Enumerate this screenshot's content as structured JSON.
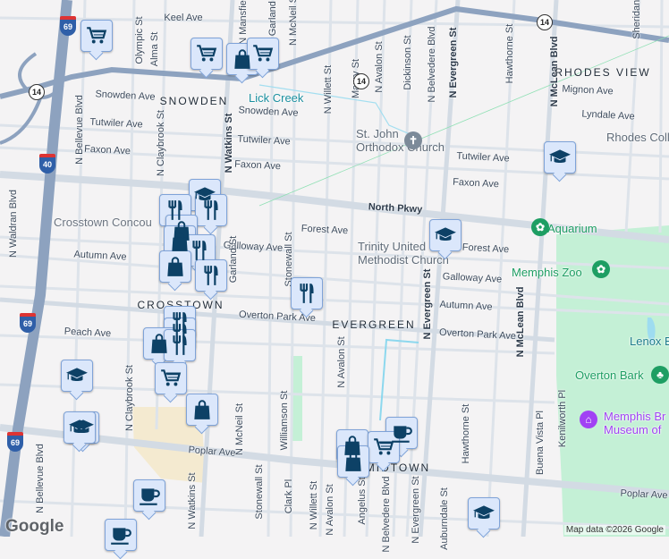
{
  "colors": {
    "road": "#d3dbe4",
    "highway": "#8da2bf",
    "park": "#bfeed3",
    "pin_icon": "#0d4166",
    "water": "#9edcf0",
    "zoo": "#1e9e63",
    "museum": "#a142f4"
  },
  "streets": [
    "Keel Ave",
    "Snowden Ave",
    "Snowden Ave",
    "Tutwiler Ave",
    "Tutwiler Ave",
    "Tutwiler Ave",
    "Faxon Ave",
    "Faxon Ave",
    "Faxon Ave",
    "North Pkwy",
    "Forest Ave",
    "Forest Ave",
    "Galloway Ave",
    "Galloway Ave",
    "Autumn Ave",
    "Autumn Ave",
    "Overton Park Ave",
    "Overton Park Ave",
    "Mignon Ave",
    "Lyndale Ave",
    "Peach Ave",
    "Poplar Ave",
    "Poplar Ave",
    "Olympic St",
    "Alma St",
    "N Mansfield St",
    "Garland St",
    "N McNeil St",
    "N Willett St",
    "Maury St",
    "N Avalon St",
    "Dickinson St",
    "N Belvedere Blvd",
    "N Evergreen St",
    "Hawthorne St",
    "N McLean Blvd",
    "Sheridan St",
    "N Bellevue Blvd",
    "N Claybrook St",
    "N Watkins St",
    "N Waldran Blvd",
    "Stonewall St",
    "Garland St",
    "N Evergreen St",
    "N Avalon St",
    "Williamson St",
    "N Claybrook St",
    "N Watkins St",
    "N McNeil St",
    "Stonewall St",
    "Clark Pl",
    "N Willett St",
    "N Avalon St",
    "Angelus St",
    "N Belvedere Blvd",
    "N Evergreen St",
    "Auburndale St",
    "Hawthorne St",
    "N McLean Blvd",
    "Buena Vista Pl",
    "Kenilworth Pl",
    "N Bellevue Blvd"
  ],
  "neighborhoods": [
    "SNOWDEN",
    "RHODES VIEW",
    "CROSSTOWN",
    "EVERGREEN",
    "MIDTOWN"
  ],
  "places": [
    {
      "name": "St. John\nOrthodox Church",
      "icon": "cross-icon"
    },
    {
      "name": "Trinity United\nMethodist Church",
      "icon": "church-icon"
    },
    {
      "name": "Rhodes Coll",
      "icon": ""
    },
    {
      "name": "Aquarium",
      "icon": "paw-icon"
    },
    {
      "name": "Memphis Zoo",
      "icon": "paw-icon"
    },
    {
      "name": "Lenox B",
      "icon": ""
    },
    {
      "name": "Overton Bark",
      "icon": "tree-icon"
    },
    {
      "name": "Memphis Br\nMuseum of",
      "icon": "museum-icon"
    },
    {
      "name": "Lick Creek",
      "icon": ""
    },
    {
      "name": "Crosstown Concou",
      "icon": ""
    }
  ],
  "markers": [
    "cart",
    "cart",
    "bag",
    "cart",
    "school",
    "school",
    "school",
    "restaurant",
    "restaurant",
    "bag",
    "bag",
    "restaurant",
    "bag",
    "restaurant",
    "restaurant",
    "restaurant",
    "restaurant",
    "bag",
    "restaurant",
    "school",
    "cart",
    "bag",
    "school",
    "school",
    "coffee",
    "bag",
    "cart",
    "bag",
    "coffee",
    "coffee",
    "school"
  ],
  "route_shields": [
    "14",
    "14",
    "14"
  ],
  "interstate_shields": [
    "69",
    "40",
    "69",
    "69"
  ],
  "attribution": "Map data ©2026 Google",
  "logo": "Google"
}
